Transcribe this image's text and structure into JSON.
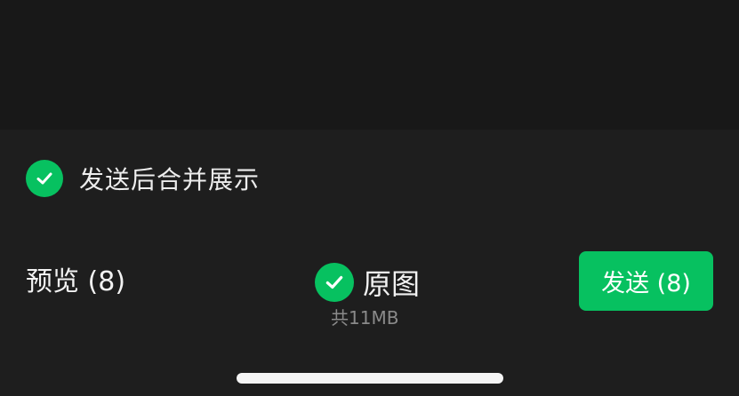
{
  "colors": {
    "accent": "#07c160",
    "background": "#1e1e1e",
    "text_primary": "#f2f2f2",
    "text_secondary": "#8a8a8a"
  },
  "merge_option": {
    "label": "发送后合并展示",
    "checked": true,
    "icon": "check-circle-icon"
  },
  "preview": {
    "label": "预览 (8)"
  },
  "original_image": {
    "label": "原图",
    "checked": true,
    "icon": "check-circle-icon",
    "size_text": "共11MB"
  },
  "send": {
    "label": "发送 (8)"
  }
}
